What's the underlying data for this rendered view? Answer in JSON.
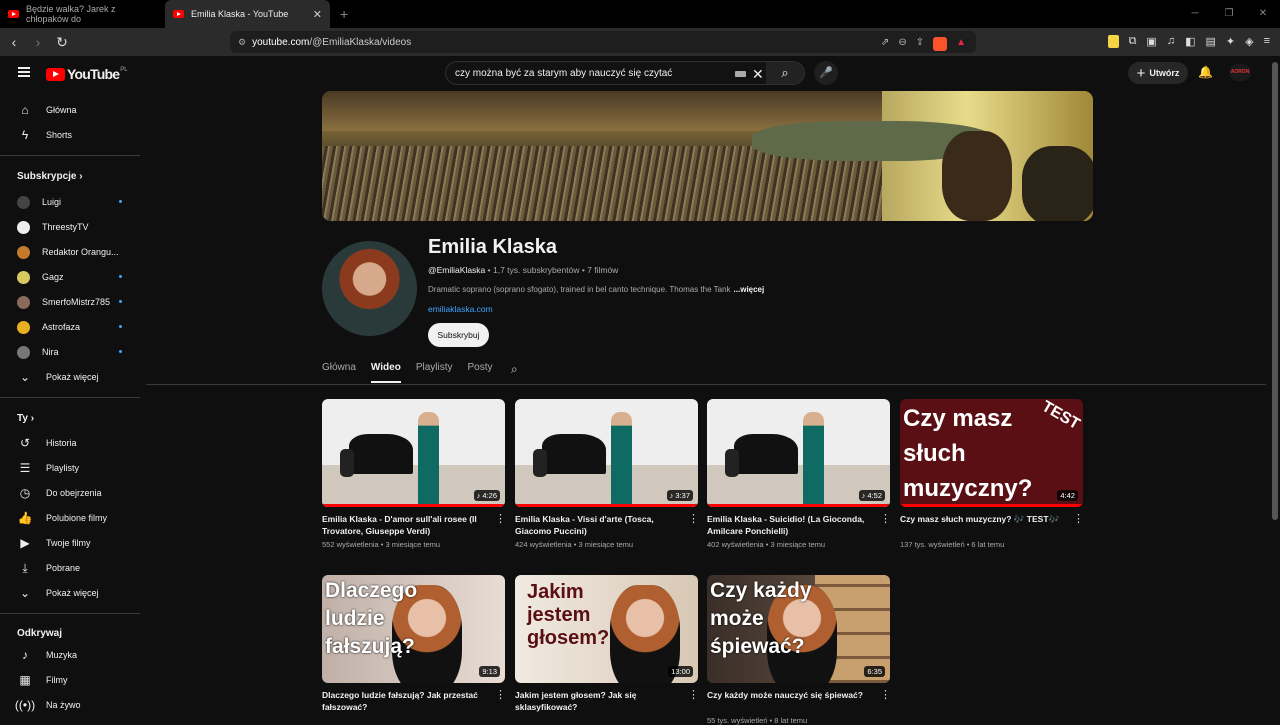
{
  "browser": {
    "tabs": [
      {
        "title": "Będzie walka? Jarek z chłopaków do"
      },
      {
        "title": "Emilia Klaska - YouTube"
      }
    ],
    "url_host": "youtube.com",
    "url_path": "/@EmiliaKlaska/videos"
  },
  "header": {
    "logo_text": "YouTube",
    "region": "PL",
    "search_value": "czy można być za starym aby nauczyć się czytać",
    "create_label": "Utwórz",
    "avatar_text": "AORON"
  },
  "sidebar": {
    "main": [
      {
        "label": "Główna",
        "icon": "home-icon"
      },
      {
        "label": "Shorts",
        "icon": "shorts-icon"
      }
    ],
    "subscriptions_heading": "Subskrypcje",
    "subscriptions": [
      {
        "label": "Luigi",
        "color": "#444444"
      },
      {
        "label": "ThreestyTV",
        "color": "#eeeeee"
      },
      {
        "label": "Redaktor Orangu...",
        "color": "#c47a2c"
      },
      {
        "label": "Gagz",
        "color": "#d8c860"
      },
      {
        "label": "SmerfoMistrz785",
        "color": "#8a6a5a"
      },
      {
        "label": "Astrofaza",
        "color": "#e8b020"
      },
      {
        "label": "Nira",
        "color": "#777777"
      }
    ],
    "show_more_1": "Pokaż więcej",
    "you_heading": "Ty",
    "you": [
      {
        "label": "Historia",
        "icon": "history-icon"
      },
      {
        "label": "Playlisty",
        "icon": "playlists-icon"
      },
      {
        "label": "Do obejrzenia",
        "icon": "watch-later-icon"
      },
      {
        "label": "Polubione filmy",
        "icon": "liked-icon"
      },
      {
        "label": "Twoje filmy",
        "icon": "your-videos-icon"
      },
      {
        "label": "Pobrane",
        "icon": "downloads-icon"
      }
    ],
    "show_more_2": "Pokaż więcej",
    "explore_heading": "Odkrywaj",
    "explore": [
      {
        "label": "Muzyka",
        "icon": "music-icon"
      },
      {
        "label": "Filmy",
        "icon": "movies-icon"
      },
      {
        "label": "Na żywo",
        "icon": "live-icon"
      }
    ]
  },
  "channel": {
    "name": "Emilia Klaska",
    "handle": "@EmiliaKlaska",
    "subscribers": " • 1,7 tys. subskrybentów • 7 filmów",
    "description": "Dramatic soprano (soprano sfogato), trained in bel canto technique. Thomas the Tank",
    "more": "...więcej",
    "link": "emiliaklaska.com",
    "subscribe_label": "Subskrybuj",
    "tabs": [
      "Główna",
      "Wideo",
      "Playlisty",
      "Posty"
    ]
  },
  "videos": [
    {
      "title": "Emilia Klaska - D'amor sull'ali rosee (Il Trovatore, Giuseppe Verdi)",
      "meta": "552 wyświetlenia • 3 miesiące temu",
      "duration": "♪ 4:26"
    },
    {
      "title": "Emilia Klaska - Vissi d'arte (Tosca, Giacomo Puccini)",
      "meta": "424 wyświetlenia • 3 miesiące temu",
      "duration": "♪ 3:37"
    },
    {
      "title": "Emilia Klaska - Suicidio! (La Gioconda, Amilcare Ponchielli)",
      "meta": "402 wyświetlenia • 3 miesiące temu",
      "duration": "♪ 4:52"
    },
    {
      "title": "Czy masz słuch muzyczny? 🎶 TEST🎶",
      "meta": "137 tys. wyświetleń • 6 lat temu",
      "duration": "4:42",
      "thumb_text": "Czy masz\nsłuch\nmuzyczny?",
      "thumb_tag": "TEST"
    },
    {
      "title": "Dlaczego ludzie fałszują? Jak przestać fałszować?",
      "meta": "",
      "duration": "9:13",
      "thumb_text": "Dlaczego ludzie fałszują?"
    },
    {
      "title": "Jakim jestem głosem? Jak się sklasyfikować?",
      "meta": "",
      "duration": "13:00",
      "thumb_text": "Jakim jestem głosem?"
    },
    {
      "title": "Czy każdy może nauczyć się śpiewać?",
      "meta": "55 tys. wyświetleń • 8 lat temu",
      "duration": "6:35",
      "thumb_text": "Czy każdy może śpiewać?"
    }
  ]
}
